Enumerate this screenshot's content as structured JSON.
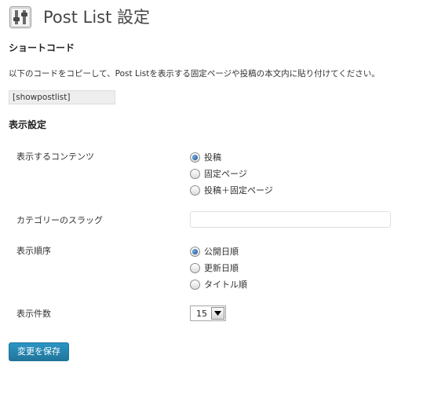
{
  "page": {
    "title": "Post List 設定",
    "icon": "settings-sliders-icon"
  },
  "shortcode_section": {
    "heading": "ショートコード",
    "instruction": "以下のコードをコピーして、Post Listを表示する固定ページや投稿の本文内に貼り付けてください。",
    "code": "[showpostlist]"
  },
  "display_section": {
    "heading": "表示設定",
    "content": {
      "label": "表示するコンテンツ",
      "options": [
        "投稿",
        "固定ページ",
        "投稿＋固定ページ"
      ],
      "selected": "投稿"
    },
    "category": {
      "label": "カテゴリーのスラッグ",
      "value": "",
      "placeholder": ""
    },
    "order": {
      "label": "表示順序",
      "options": [
        "公開日順",
        "更新日順",
        "タイトル順"
      ],
      "selected": "公開日順"
    },
    "count": {
      "label": "表示件数",
      "value": "15"
    }
  },
  "save_button": {
    "label": "変更を保存"
  },
  "colors": {
    "button_primary": "#21759b",
    "radio_checked": "#1a4f8a",
    "title_text": "#464646"
  }
}
